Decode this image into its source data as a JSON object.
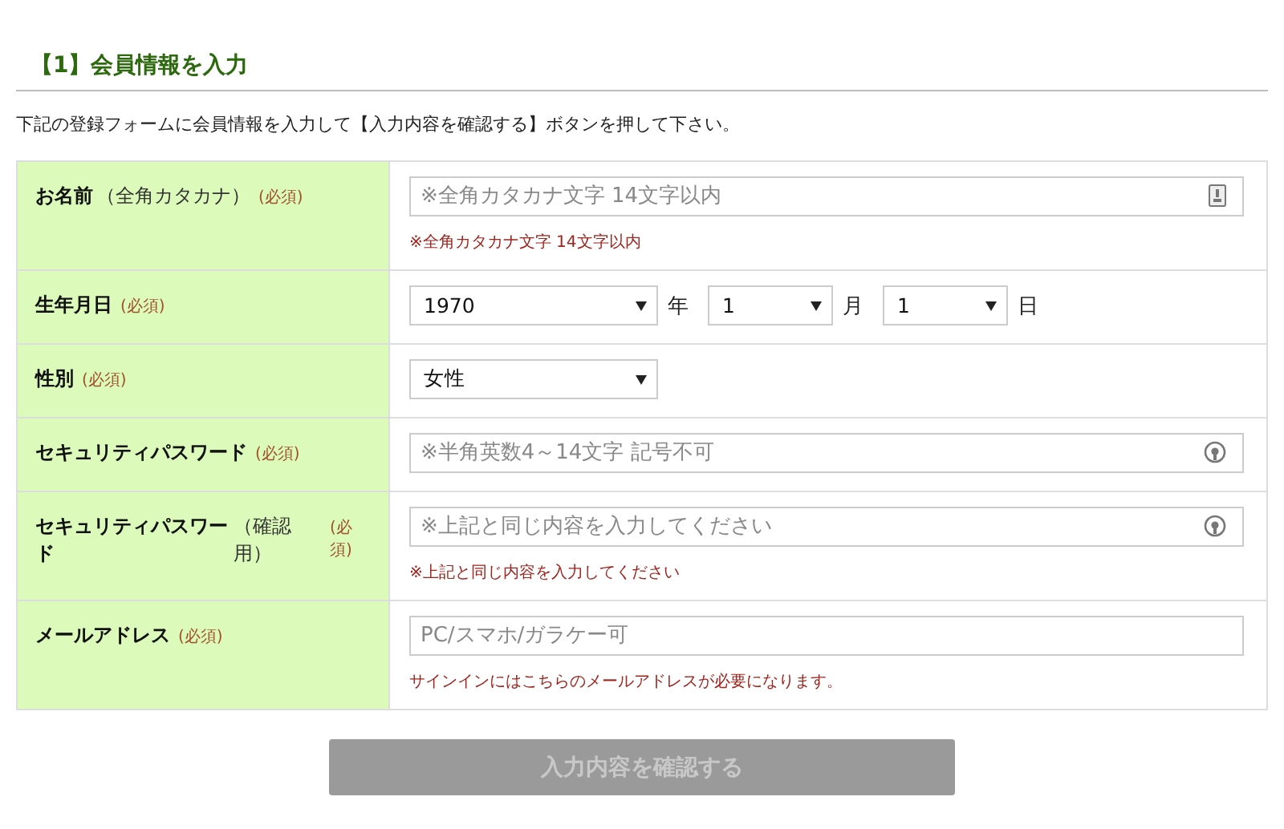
{
  "section_title": "【1】会員情報を入力",
  "intro": "下記の登録フォームに会員情報を入力して【入力内容を確認する】ボタンを押して下さい。",
  "rows": [
    {
      "kind": "text",
      "label": "お名前",
      "label_note": "（全角カタカナ）",
      "required": "(必須)",
      "placeholder": "※全角カタカナ文字 14文字以内",
      "hint": "※全角カタカナ文字 14文字以内"
    },
    {
      "kind": "date",
      "label": "生年月日",
      "required": "(必須)",
      "selects": [
        {
          "value": "1970",
          "unit": "年"
        },
        {
          "value": "1",
          "unit": "月"
        },
        {
          "value": "1",
          "unit": "日"
        }
      ]
    },
    {
      "kind": "select",
      "label": "性別",
      "required": "(必須)",
      "value": "女性"
    },
    {
      "kind": "password",
      "label": "セキュリティパスワード",
      "required": "(必須)",
      "placeholder": "※半角英数4～14文字 記号不可"
    },
    {
      "kind": "password",
      "label": "セキュリティパスワード",
      "label_note": "（確認用）",
      "required": "(必須)",
      "placeholder": "※上記と同じ内容を入力してください",
      "hint": "※上記と同じ内容を入力してください"
    },
    {
      "kind": "email",
      "label": "メールアドレス",
      "required": "(必須)",
      "placeholder": "PC/スマホ/ガラケー可",
      "hint": "サインインにはこちらのメールアドレスが必要になります。"
    }
  ],
  "submit": {
    "label": "入力内容を確認する",
    "disabled": true
  }
}
